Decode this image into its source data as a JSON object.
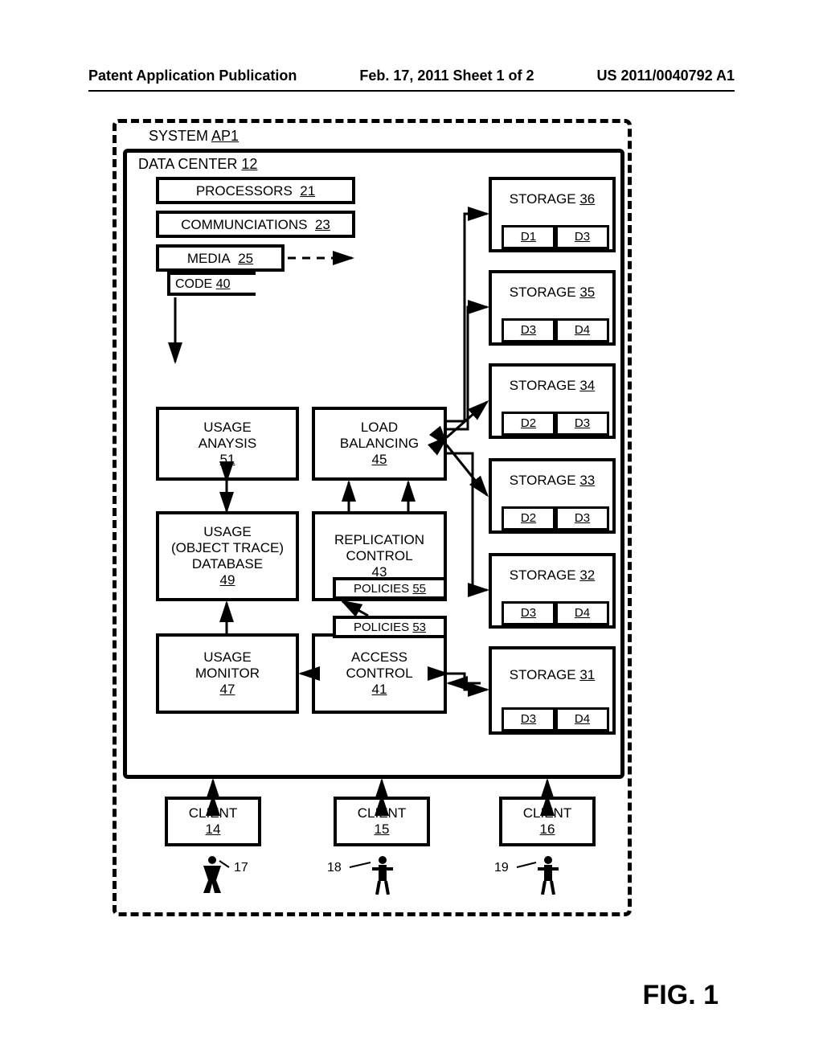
{
  "header": {
    "left": "Patent Application Publication",
    "center": "Feb. 17, 2011  Sheet 1 of 2",
    "right": "US 2011/0040792 A1"
  },
  "figure_label": "FIG. 1",
  "system": {
    "label": "SYSTEM",
    "ref": "AP1"
  },
  "datacenter": {
    "label": "DATA CENTER",
    "ref": "12",
    "processors": {
      "label": "PROCESSORS",
      "ref": "21"
    },
    "communications": {
      "label": "COMMUNCIATIONS",
      "ref": "23"
    },
    "media": {
      "label": "MEDIA",
      "ref": "25"
    },
    "code": {
      "label": "CODE",
      "ref": "40"
    }
  },
  "modules": {
    "usage_analysis": {
      "l1": "USAGE",
      "l2": "ANAYSIS",
      "ref": "51"
    },
    "load_balancing": {
      "l1": "LOAD",
      "l2": "BALANCING",
      "ref": "45"
    },
    "usage_db": {
      "l1": "USAGE",
      "l2": "(OBJECT TRACE)",
      "l3": "DATABASE",
      "ref": "49"
    },
    "replication_control": {
      "l1": "REPLICATION",
      "l2": "CONTROL",
      "ref": "43"
    },
    "usage_monitor": {
      "l1": "USAGE",
      "l2": "MONITOR",
      "ref": "47"
    },
    "access_control": {
      "l1": "ACCESS",
      "l2": "CONTROL",
      "ref": "41"
    },
    "policies55": {
      "label": "POLICIES",
      "ref": "55"
    },
    "policies53": {
      "label": "POLICIES",
      "ref": "53"
    }
  },
  "storage": {
    "s36": {
      "label": "STORAGE",
      "ref": "36",
      "d1": "D1",
      "d2": "D3"
    },
    "s35": {
      "label": "STORAGE",
      "ref": "35",
      "d1": "D3",
      "d2": "D4"
    },
    "s34": {
      "label": "STORAGE",
      "ref": "34",
      "d1": "D2",
      "d2": "D3"
    },
    "s33": {
      "label": "STORAGE",
      "ref": "33",
      "d1": "D2",
      "d2": "D3"
    },
    "s32": {
      "label": "STORAGE",
      "ref": "32",
      "d1": "D3",
      "d2": "D4"
    },
    "s31": {
      "label": "STORAGE",
      "ref": "31",
      "d1": "D3",
      "d2": "D4"
    }
  },
  "clients": {
    "c14": {
      "label": "CLIENT",
      "ref": "14"
    },
    "c15": {
      "label": "CLIENT",
      "ref": "15"
    },
    "c16": {
      "label": "CLIENT",
      "ref": "16"
    }
  },
  "people": {
    "p17": "17",
    "p18": "18",
    "p19": "19"
  }
}
